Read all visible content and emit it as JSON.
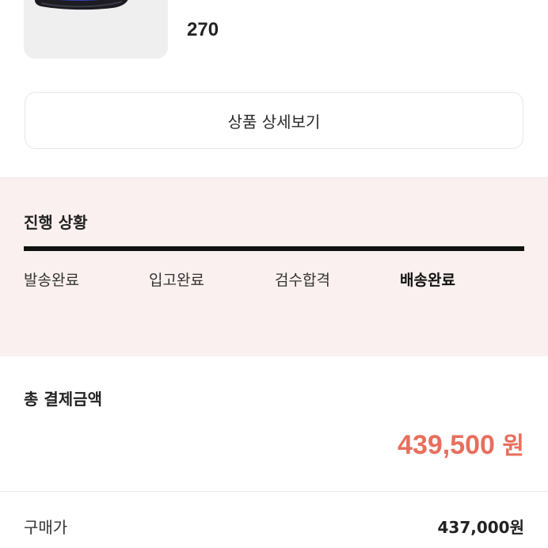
{
  "product": {
    "size": "270",
    "image_icon": "sneaker-image"
  },
  "detail_button": {
    "label": "상품 상세보기"
  },
  "progress": {
    "title": "진행 상황",
    "fraction_complete": 1.0,
    "steps": [
      {
        "label": "발송완료",
        "active": false
      },
      {
        "label": "입고완료",
        "active": false
      },
      {
        "label": "검수합격",
        "active": false
      },
      {
        "label": "배송완료",
        "active": true
      }
    ]
  },
  "payment": {
    "title": "총 결제금액",
    "amount": "439,500",
    "unit": "원",
    "amount_color": "#e86e5d"
  },
  "breakdown": {
    "purchase_label": "구매가",
    "purchase_value": "437,000원"
  },
  "colors": {
    "progress_background": "#f9f0ef",
    "accent": "#e86e5d"
  }
}
